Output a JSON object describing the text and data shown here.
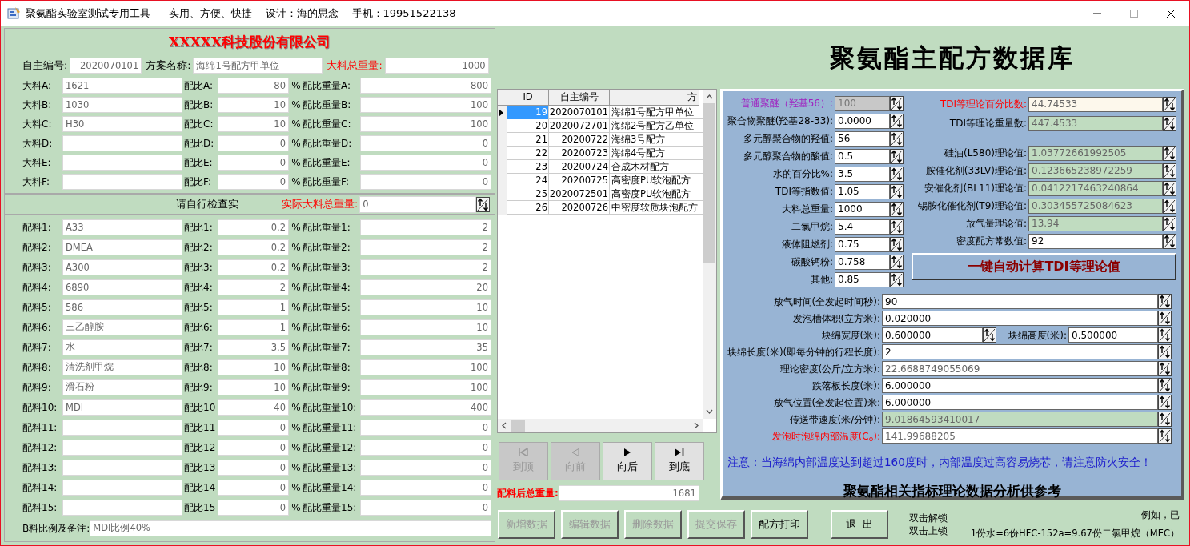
{
  "window": {
    "title": "聚氨酯实验室测试专用工具-----实用、方便、快捷    设计：海的思念    手机：19951522138"
  },
  "company": "XXXXX科技股份有限公司",
  "header_fields": [
    {
      "label": "自主编号:",
      "value": "2020070101",
      "emphasis": false
    },
    {
      "label": "方案名称:",
      "value": "海绵1号配方甲单位",
      "emphasis": false
    },
    {
      "label": "大料总重量:",
      "value": "1000",
      "emphasis": true
    }
  ],
  "main_rows": [
    {
      "name_label": "大料A:",
      "name_value": "1621",
      "ratio_label": "配比A:",
      "ratio_value": "80",
      "unit": "%",
      "weight_label": "配比重量A:",
      "weight_value": "800"
    },
    {
      "name_label": "大料B:",
      "name_value": "1030",
      "ratio_label": "配比B:",
      "ratio_value": "10",
      "unit": "%",
      "weight_label": "配比重量B:",
      "weight_value": "100"
    },
    {
      "name_label": "大料C:",
      "name_value": "H30",
      "ratio_label": "配比C:",
      "ratio_value": "10",
      "unit": "%",
      "weight_label": "配比重量C:",
      "weight_value": "100"
    },
    {
      "name_label": "大料D:",
      "ratio_label": "配比D:",
      "ratio_value": "0",
      "unit": "%",
      "weight_label": "配比重量D:",
      "weight_value": "0"
    },
    {
      "name_label": "大料E:",
      "ratio_label": "配比E:",
      "ratio_value": "0",
      "unit": "%",
      "weight_label": "配比重量E:",
      "weight_value": "0"
    },
    {
      "name_label": "大料F:",
      "ratio_label": "配比F:",
      "ratio_value": "0",
      "unit": "%",
      "weight_label": "配比重量F:",
      "weight_value": "0"
    }
  ],
  "check_row": {
    "note": "请自行检查实",
    "total_label": "实际大料总重量:",
    "total_value": "0"
  },
  "additive_rows": [
    {
      "name_label": "配料1:",
      "name_value": "A33",
      "ratio_label": "配比1:",
      "ratio_value": "0.2",
      "unit": "%",
      "weight_label": "配比重量1:",
      "weight_value": "2"
    },
    {
      "name_label": "配料2:",
      "name_value": "DMEA",
      "ratio_label": "配比2:",
      "ratio_value": "0.2",
      "unit": "%",
      "weight_label": "配比重量2:",
      "weight_value": "2"
    },
    {
      "name_label": "配料3:",
      "name_value": "A300",
      "ratio_label": "配比3:",
      "ratio_value": "0.2",
      "unit": "%",
      "weight_label": "配比重量3:",
      "weight_value": "2"
    },
    {
      "name_label": "配料4:",
      "name_value": "6890",
      "ratio_label": "配比4:",
      "ratio_value": "2",
      "unit": "%",
      "weight_label": "配比重量4:",
      "weight_value": "20"
    },
    {
      "name_label": "配料5:",
      "name_value": "586",
      "ratio_label": "配比5:",
      "ratio_value": "1",
      "unit": "%",
      "weight_label": "配比重量5:",
      "weight_value": "10"
    },
    {
      "name_label": "配料6:",
      "name_value": "三乙醇胺",
      "ratio_label": "配比6:",
      "ratio_value": "1",
      "unit": "%",
      "weight_label": "配比重量6:",
      "weight_value": "10"
    },
    {
      "name_label": "配料7:",
      "name_value": "水",
      "ratio_label": "配比7:",
      "ratio_value": "3.5",
      "unit": "%",
      "weight_label": "配比重量7:",
      "weight_value": "35"
    },
    {
      "name_label": "配料8:",
      "name_value": "清洗剂甲烷",
      "ratio_label": "配比8:",
      "ratio_value": "10",
      "unit": "%",
      "weight_label": "配比重量8:",
      "weight_value": "100"
    },
    {
      "name_label": "配料9:",
      "name_value": "滑石粉",
      "ratio_label": "配比9:",
      "ratio_value": "10",
      "unit": "%",
      "weight_label": "配比重量9:",
      "weight_value": "100"
    },
    {
      "name_label": "配料10:",
      "name_value": "MDI",
      "ratio_label": "配比10",
      "ratio_value": "40",
      "unit": "%",
      "weight_label": "配比重量10:",
      "weight_value": "400"
    },
    {
      "name_label": "配料11:",
      "ratio_label": "配比11",
      "ratio_value": "0",
      "unit": "%",
      "weight_label": "配比重量11:",
      "weight_value": "0"
    },
    {
      "name_label": "配料12:",
      "ratio_label": "配比12",
      "ratio_value": "0",
      "unit": "%",
      "weight_label": "配比重量12:",
      "weight_value": "0"
    },
    {
      "name_label": "配料13:",
      "ratio_label": "配比13",
      "ratio_value": "0",
      "unit": "%",
      "weight_label": "配比重量13:",
      "weight_value": "0"
    },
    {
      "name_label": "配料14:",
      "ratio_label": "配比14",
      "ratio_value": "0",
      "unit": "%",
      "weight_label": "配比重量14:",
      "weight_value": "0"
    },
    {
      "name_label": "配料15:",
      "ratio_label": "配比15",
      "ratio_value": "0",
      "unit": "%",
      "weight_label": "配比重量15:",
      "weight_value": "0"
    }
  ],
  "remark": {
    "label": "B料比例及备注:",
    "value": "MDI比例40%"
  },
  "table": {
    "columns": [
      "ID",
      "自主编号",
      "方"
    ],
    "rows": [
      {
        "cells": [
          "19",
          "2020070101",
          "海绵1号配方甲单位"
        ],
        "selected": true
      },
      {
        "cells": [
          "20",
          "2020072701",
          "海绵2号配方乙单位"
        ],
        "selected": false
      },
      {
        "cells": [
          "21",
          "20200722",
          "海绵3号配方"
        ],
        "selected": false
      },
      {
        "cells": [
          "22",
          "20200723",
          "海绵4号配方"
        ],
        "selected": false
      },
      {
        "cells": [
          "23",
          "20200724",
          "合成木材配方"
        ],
        "selected": false
      },
      {
        "cells": [
          "24",
          "20200725",
          "高密度PU软泡配方"
        ],
        "selected": false
      },
      {
        "cells": [
          "25",
          "2020072501",
          "高密度PU软泡配方"
        ],
        "selected": false
      },
      {
        "cells": [
          "26",
          "20200726",
          "中密度软质块泡配方"
        ],
        "selected": false
      }
    ]
  },
  "nav_buttons": [
    {
      "kind": "first",
      "label": "到顶",
      "disabled": true
    },
    {
      "kind": "prev",
      "label": "向前",
      "disabled": true
    },
    {
      "kind": "next",
      "label": "向后",
      "disabled": false
    },
    {
      "kind": "last",
      "label": "到底",
      "disabled": false
    }
  ],
  "after_total": {
    "label": "配料后总重量:",
    "value": "1681"
  },
  "db_title": "聚氨酯主配方数据库",
  "input_fields": [
    {
      "label": "普通聚醚（羟基56）:",
      "value": "100",
      "kind": "disabled",
      "color": "#a020c0"
    },
    {
      "label": "聚合物聚醚(羟基28-33):",
      "value": "0.0000",
      "kind": "input"
    },
    {
      "label": "多元醇聚合物的羟值:",
      "value": "56",
      "kind": "input"
    },
    {
      "label": "多元醇聚合物的酸值:",
      "value": "0.5",
      "kind": "input"
    },
    {
      "label": "水的百分比%:",
      "value": "3.5",
      "kind": "input"
    },
    {
      "label": "TDI等指数值:",
      "value": "1.05",
      "kind": "input"
    },
    {
      "label": "大料总重量:",
      "value": "1000",
      "kind": "input"
    },
    {
      "label": "二氯甲烷:",
      "value": "5.4",
      "kind": "input"
    },
    {
      "label": "液体阻燃剂:",
      "value": "0.75",
      "kind": "input"
    },
    {
      "label": "碳酸钙粉:",
      "value": "0.758",
      "kind": "input"
    },
    {
      "label": "其他:",
      "value": "0.85",
      "kind": "input"
    }
  ],
  "tdi_fields": [
    {
      "label": "TDI等理论百分比数:",
      "value": "44.74533",
      "kind": "target",
      "color": "#ff0000"
    },
    {
      "label": "TDI等理论重量数:",
      "value": "447.4533",
      "kind": "computed"
    }
  ],
  "theory_fields": [
    {
      "label": "硅油(L580)理论值:",
      "value": "1.03772661992505",
      "kind": "computed"
    },
    {
      "label": "胺催化剂(33LV)理论值:",
      "value": "0.123665238972259",
      "kind": "computed"
    },
    {
      "label": "安催化剂(BL11)理论值:",
      "value": "0.0412217463240864",
      "kind": "computed"
    },
    {
      "label": "锡胺化催化剂(T9)理论值:",
      "value": "0.303455725084623",
      "kind": "computed"
    },
    {
      "label": "放气量理论值:",
      "value": "13.94",
      "kind": "computed"
    },
    {
      "label": "密度配方常数值:",
      "value": "92",
      "kind": "input"
    }
  ],
  "calc_button": "一键自动计算TDI等理论值",
  "foam_rows": [
    {
      "fields": [
        {
          "label": "放气时间(全发起时间秒):",
          "value": "90",
          "kind": "input"
        }
      ]
    },
    {
      "fields": [
        {
          "label": "发泡槽体积(立方米):",
          "value": "0.020000",
          "kind": "input"
        }
      ]
    },
    {
      "fields": [
        {
          "label": "块绵宽度(米):",
          "value": "0.600000",
          "kind": "input"
        },
        {
          "label": "块绵高度(米):",
          "value": "0.500000",
          "kind": "input"
        }
      ]
    },
    {
      "fields": [
        {
          "label": "块绵长度(米)(即每分钟的行程长度):",
          "value": "2",
          "kind": "input"
        }
      ]
    },
    {
      "fields": [
        {
          "label": "理论密度(公斤/立方米):",
          "value": "22.6688749055069",
          "kind": "readonly"
        }
      ]
    },
    {
      "fields": [
        {
          "label": "跌落板长度(米):",
          "value": "6.000000",
          "kind": "input"
        }
      ]
    },
    {
      "fields": [
        {
          "label": "放气位置(全发起位置)米:",
          "value": "6.000000",
          "kind": "input"
        }
      ]
    },
    {
      "fields": [
        {
          "label": "传送带速度(米/分钟):",
          "value": "9.01864593410017",
          "kind": "computed"
        }
      ]
    },
    {
      "fields": [
        {
          "label": "发泡时泡绵内部温度(C$_{o}$):",
          "value": "141.99688205",
          "kind": "readonly",
          "color": "#ff0000"
        }
      ]
    }
  ],
  "warning": "注意：当海绵内部温度达到超过160度时，内部温度过高容易烧芯，请注意防火安全！",
  "panel_footer": "聚氨酯相关指标理论数据分析供参考",
  "action_buttons": [
    {
      "label": "新增数据",
      "disabled": true
    },
    {
      "label": "编辑数据",
      "disabled": true
    },
    {
      "label": "删除数据",
      "disabled": true
    },
    {
      "label": "提交保存",
      "disabled": true
    },
    {
      "label": "配方打印",
      "disabled": false
    },
    {
      "label": "退  出",
      "disabled": false
    }
  ],
  "lock_notes": [
    "双击解锁",
    "双击上锁"
  ],
  "example_notes": [
    "例如，已",
    "1份水=6份HFC-152a=9.67份二氯甲烷（MEC）"
  ]
}
